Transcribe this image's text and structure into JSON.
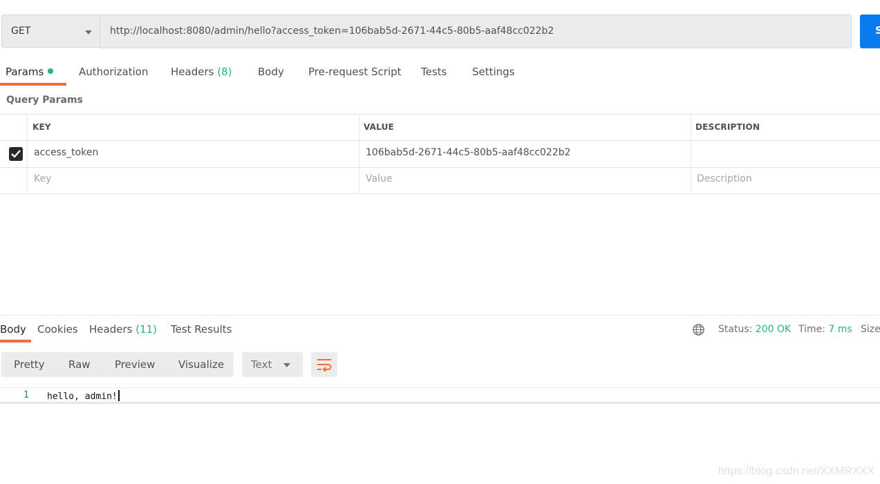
{
  "request": {
    "method": "GET",
    "url": "http://localhost:8080/admin/hello?access_token=106bab5d-2671-44c5-80b5-aaf48cc022b2",
    "send_label": "S"
  },
  "request_tabs": {
    "params": "Params",
    "authorization": "Authorization",
    "headers": "Headers",
    "headers_count": "(8)",
    "body": "Body",
    "pre_request": "Pre-request Script",
    "tests": "Tests",
    "settings": "Settings"
  },
  "query_params": {
    "title": "Query Params",
    "columns": {
      "key": "KEY",
      "value": "VALUE",
      "description": "DESCRIPTION"
    },
    "rows": [
      {
        "checked": true,
        "key": "access_token",
        "value": "106bab5d-2671-44c5-80b5-aaf48cc022b2",
        "description": ""
      }
    ],
    "placeholders": {
      "key": "Key",
      "value": "Value",
      "description": "Description"
    }
  },
  "response_tabs": {
    "body": "Body",
    "cookies": "Cookies",
    "headers": "Headers",
    "headers_count": "(11)",
    "test_results": "Test Results"
  },
  "status": {
    "status_label": "Status:",
    "status_value": "200 OK",
    "time_label": "Time:",
    "time_value": "7 ms",
    "size_label": "Size:"
  },
  "view": {
    "pretty": "Pretty",
    "raw": "Raw",
    "preview": "Preview",
    "visualize": "Visualize",
    "format": "Text"
  },
  "response_body": {
    "line_number": "1",
    "content": "hello, admin!"
  },
  "watermark": "https://blog.csdn.net/XXMRXXX",
  "colors": {
    "accent": "#f26b3a",
    "send": "#097bed",
    "success": "#26b47f"
  }
}
